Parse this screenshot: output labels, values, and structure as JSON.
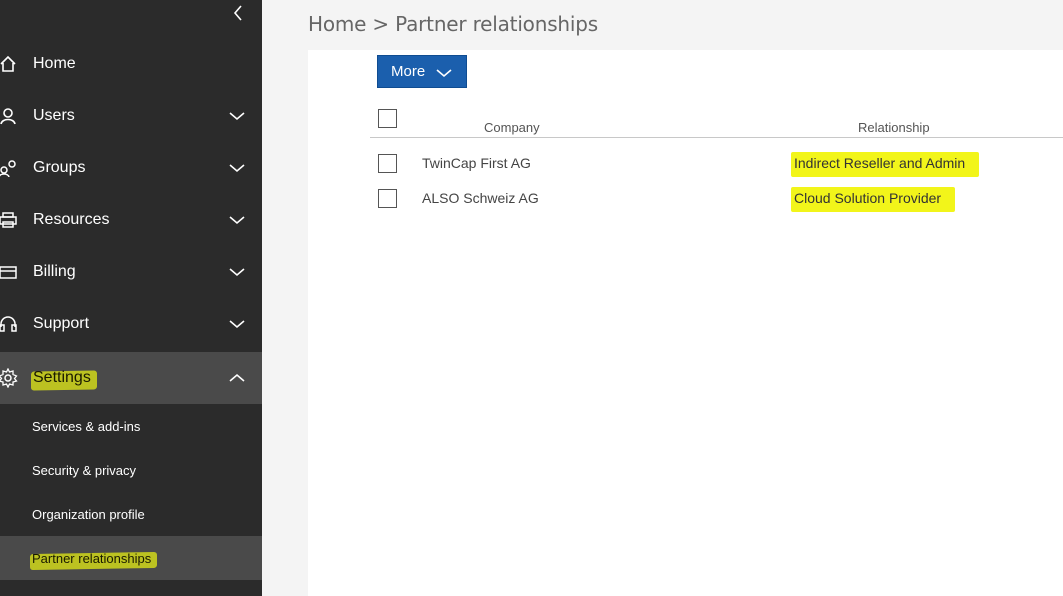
{
  "breadcrumb": "Home > Partner relationships",
  "sidebar": {
    "items": [
      {
        "label": "Home",
        "icon": "home-icon"
      },
      {
        "label": "Users",
        "icon": "user-icon"
      },
      {
        "label": "Groups",
        "icon": "groups-icon"
      },
      {
        "label": "Resources",
        "icon": "printer-icon"
      },
      {
        "label": "Billing",
        "icon": "credit-card-icon"
      },
      {
        "label": "Support",
        "icon": "headset-icon"
      },
      {
        "label": "Settings",
        "icon": "gear-icon"
      }
    ],
    "sub_items": [
      {
        "label": "Services & add-ins"
      },
      {
        "label": "Security & privacy"
      },
      {
        "label": "Organization profile"
      },
      {
        "label": "Partner relationships"
      }
    ]
  },
  "toolbar": {
    "more_label": "More"
  },
  "table": {
    "columns": [
      "Company",
      "Relationship"
    ],
    "rows": [
      {
        "company": "TwinCap First AG",
        "relationship": "Indirect Reseller and Admin"
      },
      {
        "company": "ALSO Schweiz AG",
        "relationship": "Cloud Solution Provider"
      }
    ]
  },
  "colors": {
    "sidebar_bg": "#2b2b2b",
    "sidebar_expanded": "#4a4a4a",
    "accent": "#1b5fad",
    "highlight": "#f2f51a"
  }
}
